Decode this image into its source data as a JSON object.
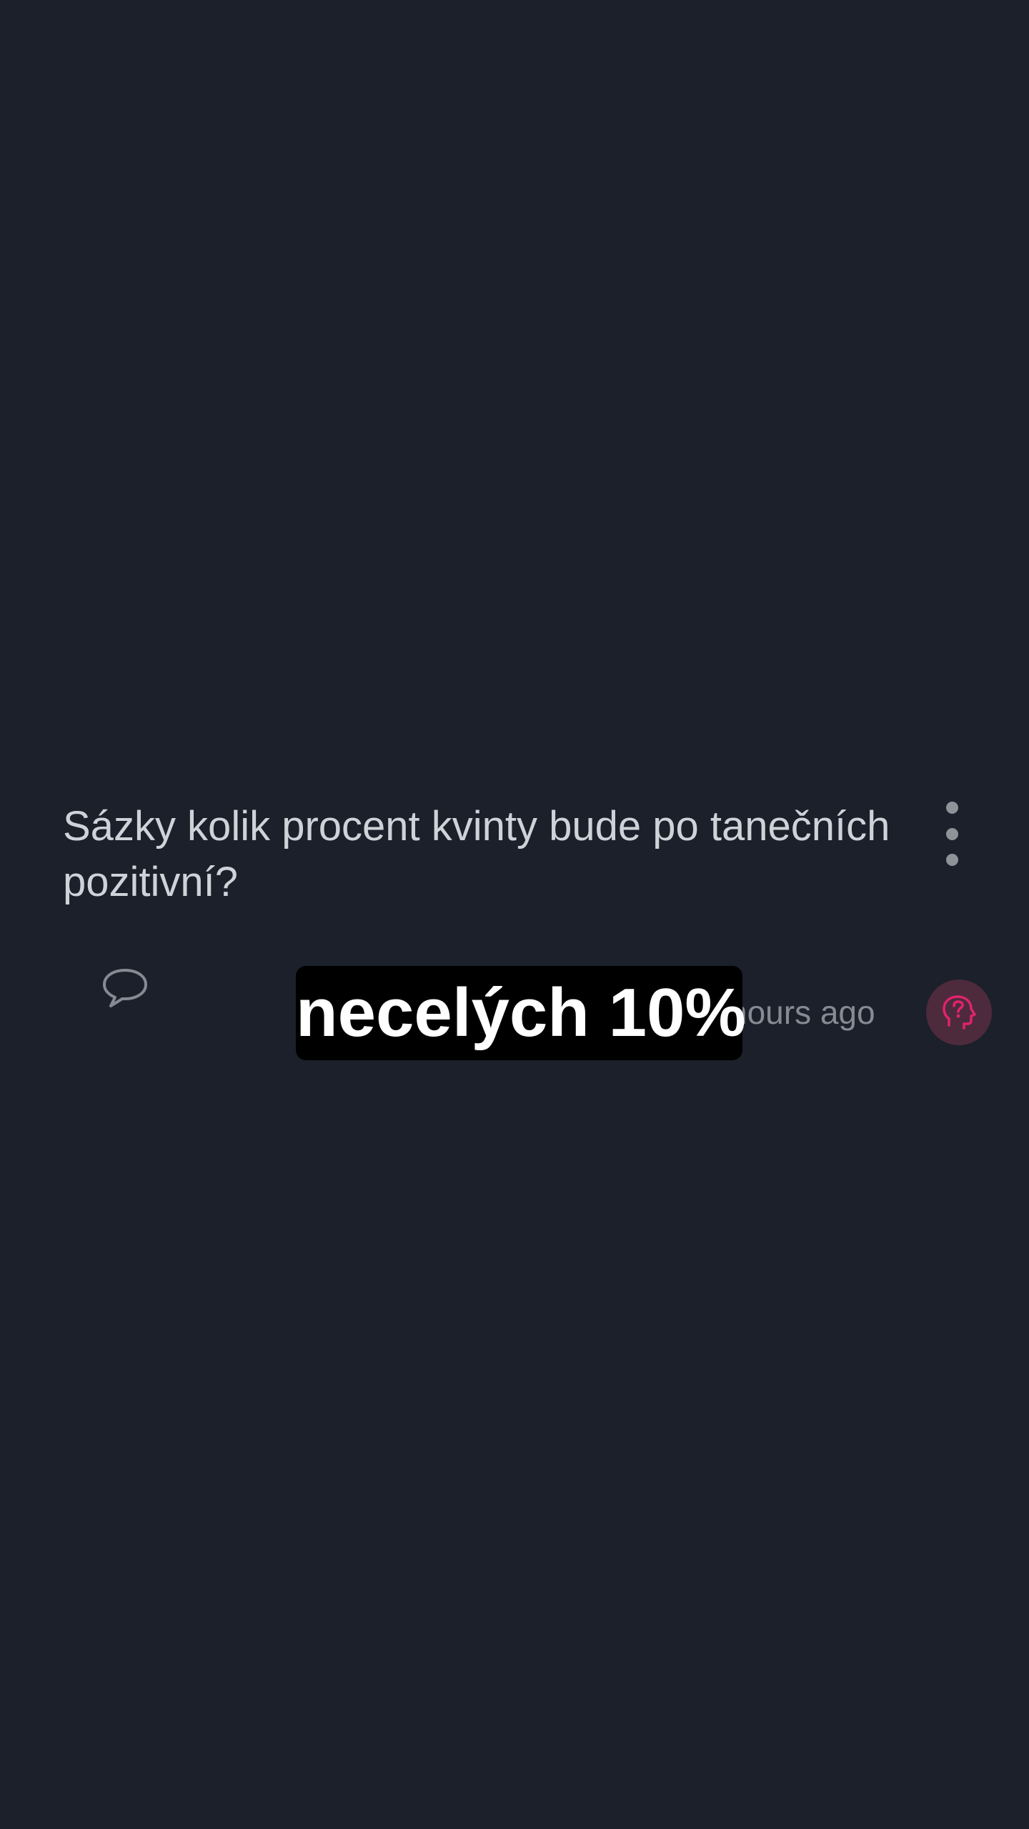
{
  "post": {
    "question": "Sázky kolik procent kvinty bude po tanečních pozitivní?",
    "timestamp": "hours ago",
    "more_icon": "more-vertical-icon",
    "comment_icon": "speech-bubble-icon",
    "avatar_icon": "head-question-icon"
  },
  "overlay": {
    "caption": "necelých 10%"
  },
  "colors": {
    "background": "#1b202a",
    "text": "#cfd2d8",
    "muted": "#868b93",
    "avatar_bg": "#4d2b3c",
    "avatar_accent": "#e0236a"
  }
}
